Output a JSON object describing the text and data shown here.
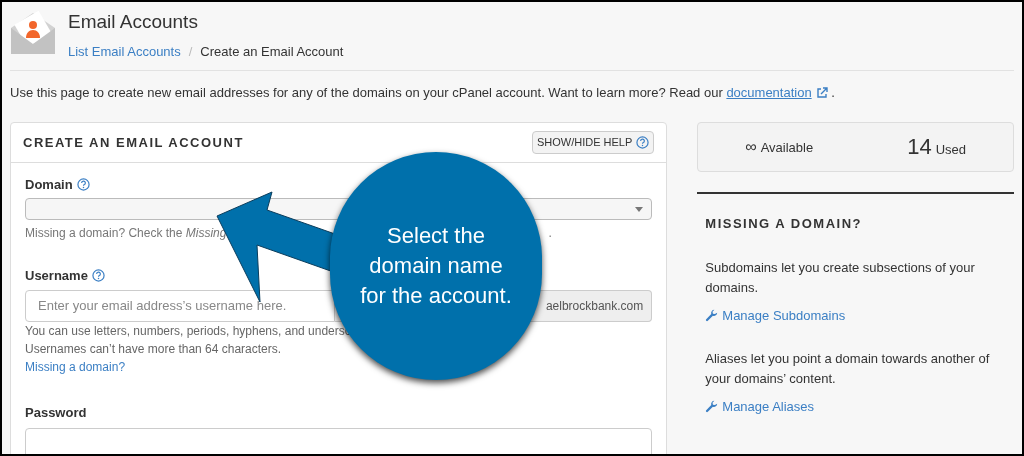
{
  "header": {
    "title": "Email Accounts",
    "separator": "/",
    "breadcrumb": [
      {
        "label": "List Email Accounts",
        "link": true
      },
      {
        "label": "Create an Email Account",
        "link": false
      }
    ]
  },
  "intro": {
    "text": "Use this page to create new email addresses for any of the domains on your cPanel account. Want to learn more? Read our",
    "link": "documentation",
    "tail": "."
  },
  "form": {
    "title": "CREATE AN EMAIL ACCOUNT",
    "help_button": "SHOW/HIDE HELP",
    "domain": {
      "label": "Domain",
      "hint": "Missing a domain? Check the *Missing*",
      "hint_tail": "."
    },
    "username": {
      "label": "Username",
      "placeholder": "Enter your email address’s username here.",
      "suffix": "aelbrockbank.com",
      "hints": [
        "You can use letters, numbers, periods, hyphens, and undersc",
        "Usernames can’t have more than 64 characters."
      ],
      "link": "Missing a domain?"
    },
    "password": {
      "label": "Password"
    }
  },
  "stats": [
    {
      "value": "∞",
      "label": "Available",
      "kind": "icon"
    },
    {
      "value": "14",
      "label": "Used",
      "kind": "number"
    }
  ],
  "sidebar": {
    "title": "MISSING A DOMAIN?",
    "sections": [
      {
        "text": "Subdomains let you create subsections of your domains.",
        "link": "Manage Subdomains"
      },
      {
        "text": "Aliases let you point a domain towards another of your domains’ content.",
        "link": "Manage Aliases"
      }
    ]
  },
  "callout": {
    "text": "Select the domain name for the account."
  }
}
